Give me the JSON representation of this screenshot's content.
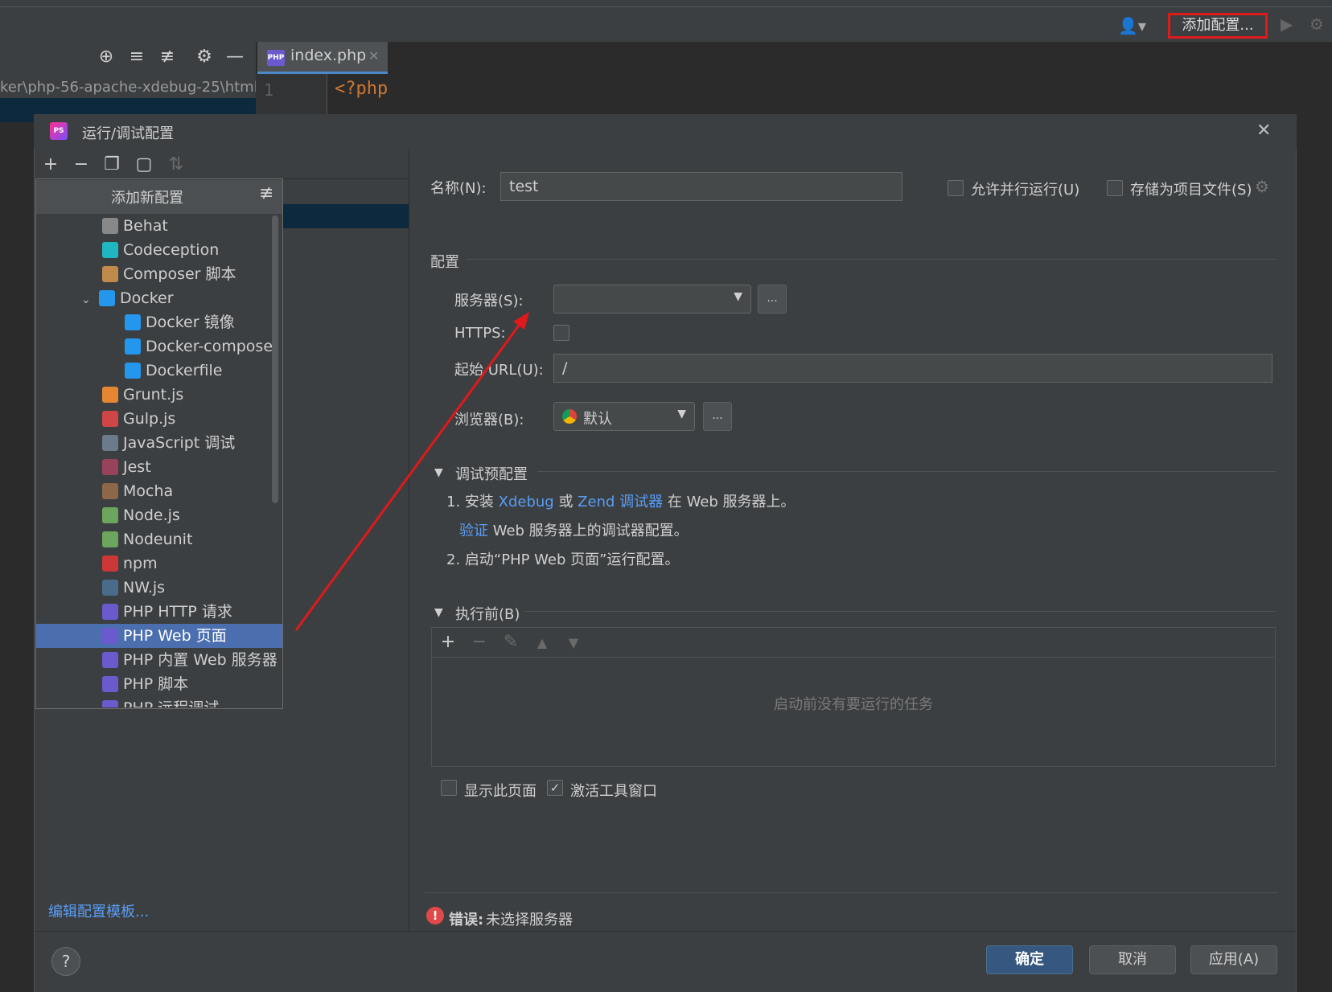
{
  "ide": {
    "add_config_label": "添加配置...",
    "tab_label": "index.php",
    "tab_icon_text": "PHP",
    "path_text": "ker\\php-56-apache-xdebug-25\\html",
    "line_number": "1",
    "code_line": "<?php"
  },
  "dialog": {
    "title": "运行/调试配置",
    "logo_text": "PS",
    "popup": {
      "title": "添加新配置",
      "items": [
        {
          "label": "Behat",
          "icon": "behat-icon",
          "color": "#888888"
        },
        {
          "label": "Codeception",
          "icon": "codeception-icon",
          "color": "#1fb6c1"
        },
        {
          "label": "Composer 脚本",
          "icon": "composer-icon",
          "color": "#c08a4a"
        },
        {
          "label": "Docker",
          "icon": "docker-icon",
          "color": "#2496ed"
        },
        {
          "label": "Docker 镜像",
          "icon": "docker-icon",
          "color": "#2496ed"
        },
        {
          "label": "Docker-compose",
          "icon": "docker-icon",
          "color": "#2496ed"
        },
        {
          "label": "Dockerfile",
          "icon": "docker-icon",
          "color": "#2496ed"
        },
        {
          "label": "Grunt.js",
          "icon": "grunt-icon",
          "color": "#e48632"
        },
        {
          "label": "Gulp.js",
          "icon": "gulp-icon",
          "color": "#cf4647"
        },
        {
          "label": "JavaScript 调试",
          "icon": "js-debug-icon",
          "color": "#6b7b8c"
        },
        {
          "label": "Jest",
          "icon": "jest-icon",
          "color": "#99425b"
        },
        {
          "label": "Mocha",
          "icon": "mocha-icon",
          "color": "#8d6748"
        },
        {
          "label": "Node.js",
          "icon": "nodejs-icon",
          "color": "#6da55f"
        },
        {
          "label": "Nodeunit",
          "icon": "nodeunit-icon",
          "color": "#6da55f"
        },
        {
          "label": "npm",
          "icon": "npm-icon",
          "color": "#cb3837"
        },
        {
          "label": "NW.js",
          "icon": "nwjs-icon",
          "color": "#4a6b8a"
        },
        {
          "label": "PHP HTTP 请求",
          "icon": "php-http-icon",
          "color": "#6a5acd"
        },
        {
          "label": "PHP Web 页面",
          "icon": "php-web-icon",
          "color": "#6a5acd"
        },
        {
          "label": "PHP 内置 Web 服务器",
          "icon": "php-server-icon",
          "color": "#6a5acd"
        },
        {
          "label": "PHP 脚本",
          "icon": "php-script-icon",
          "color": "#6a5acd"
        },
        {
          "label": "PHP 远程调试",
          "icon": "php-remote-icon",
          "color": "#6a5acd"
        }
      ]
    },
    "edit_templates": "编辑配置模板...",
    "name_label": "名称(N):",
    "name_value": "test",
    "allow_parallel": "允许并行运行(U)",
    "store_as_file": "存储为项目文件(S)",
    "config_section": "配置",
    "server_label": "服务器(S):",
    "browse_button": "...",
    "https_label": "HTTPS:",
    "start_url_label": "起始 URL(U):",
    "start_url_value": "/",
    "browser_label": "浏览器(B):",
    "browser_value": "默认",
    "debug_section": "调试预配置",
    "step1_prefix": "1. 安装 ",
    "step1_link1": "Xdebug",
    "step1_mid": " 或 ",
    "step1_link2": "Zend 调试器",
    "step1_suffix": " 在 Web 服务器上。",
    "verify_link": "验证",
    "verify_suffix": " Web 服务器上的调试器配置。",
    "step2": "2. 启动“PHP Web 页面”运行配置。",
    "before_section": "执行前(B)",
    "before_empty": "启动前没有要运行的任务",
    "show_page": "显示此页面",
    "activate_tool_window": "激活工具窗口",
    "error_label": "错误:",
    "error_text": "未选择服务器",
    "help": "?",
    "ok": "确定",
    "cancel": "取消",
    "apply": "应用(A)"
  },
  "colors": {
    "accent": "#4b6eaf",
    "link": "#589df6",
    "annotation": "#e0191b"
  }
}
